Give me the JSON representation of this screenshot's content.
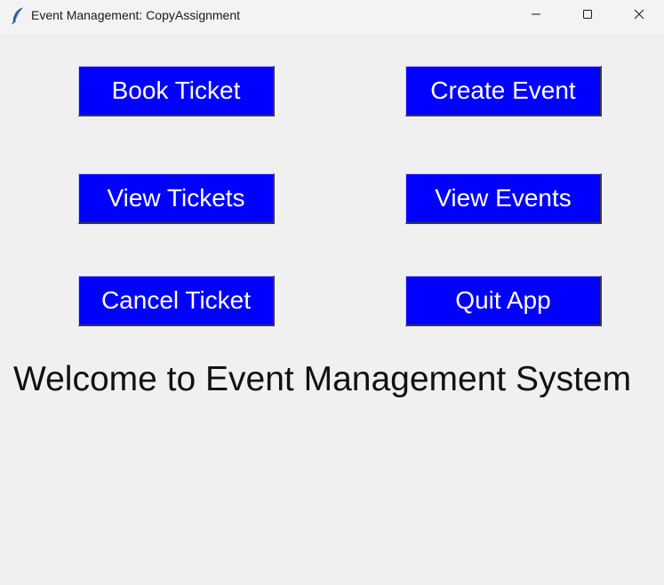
{
  "window": {
    "title": "Event Management: CopyAssignment",
    "icon": "feather-icon",
    "controls": {
      "minimize": "minimize-icon",
      "maximize": "maximize-icon",
      "close": "close-icon"
    }
  },
  "buttons": {
    "book_ticket": "Book Ticket",
    "create_event": "Create Event",
    "view_tickets": "View Tickets",
    "view_events": "View Events",
    "cancel_ticket": "Cancel Ticket",
    "quit_app": "Quit App"
  },
  "welcome_message": "Welcome to Event Management System",
  "colors": {
    "button_bg": "#0000ff",
    "button_text": "#ffffff",
    "window_bg": "#f0f0f0"
  }
}
